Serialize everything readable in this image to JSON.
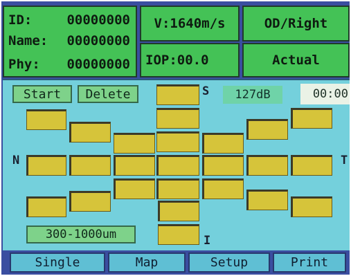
{
  "patient": {
    "id_label": "ID:",
    "id_value": "00000000",
    "name_label": "Name:",
    "name_value": "00000000",
    "phy_label": "Phy:",
    "phy_value": "00000000"
  },
  "velocity": "V:1640m/s",
  "iop": "IOP:00.0",
  "eye": "OD/Right",
  "mode": "Actual",
  "toolbar": {
    "start_label": "Start",
    "delete_label": "Delete"
  },
  "gain": "127dB",
  "timer": "00:00",
  "range": "300-1000um",
  "orientation": {
    "superior": "S",
    "nasal": "N",
    "temporal": "T",
    "inferior": "I"
  },
  "tabs": [
    "Single",
    "Map",
    "Setup",
    "Print"
  ],
  "colors": {
    "header_green": "#44c256",
    "map_background": "#74d0dc",
    "cell_yellow": "#d6c43a",
    "frame_blue": "#3a4ea0",
    "tab_cyan": "#5fbfd4"
  }
}
